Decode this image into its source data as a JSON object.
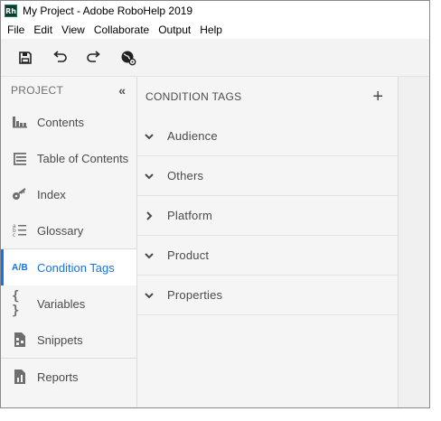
{
  "window": {
    "title": "My Project - Adobe RoboHelp 2019",
    "app_icon_text": "Rh"
  },
  "menu": [
    "File",
    "Edit",
    "View",
    "Collaborate",
    "Output",
    "Help"
  ],
  "toolbar": {
    "buttons": [
      "save-icon",
      "undo-icon",
      "redo-icon",
      "globe-settings-icon"
    ]
  },
  "sidebar": {
    "title": "PROJECT",
    "collapse_glyph": "«",
    "items": [
      {
        "label": "Contents",
        "icon": "contents-icon"
      },
      {
        "label": "Table of Contents",
        "icon": "toc-icon"
      },
      {
        "label": "Index",
        "icon": "key-icon"
      },
      {
        "label": "Glossary",
        "icon": "glossary-icon"
      },
      {
        "label": "Condition Tags",
        "icon": "ab-icon",
        "icon_text": "A/B",
        "active": true
      },
      {
        "label": "Variables",
        "icon": "curly-braces-icon",
        "icon_text": "{ }"
      },
      {
        "label": "Snippets",
        "icon": "snippet-icon"
      },
      {
        "label": "Reports",
        "icon": "report-icon"
      }
    ]
  },
  "panel": {
    "title": "CONDITION TAGS",
    "add_glyph": "+",
    "tags": [
      {
        "label": "Audience",
        "expanded": true
      },
      {
        "label": "Others",
        "expanded": true
      },
      {
        "label": "Platform",
        "expanded": false
      },
      {
        "label": "Product",
        "expanded": true
      },
      {
        "label": "Properties",
        "expanded": true
      }
    ]
  },
  "colors": {
    "accent": "#1473e6",
    "text": "#4b4b4b",
    "panel_bg": "#f5f5f5"
  }
}
